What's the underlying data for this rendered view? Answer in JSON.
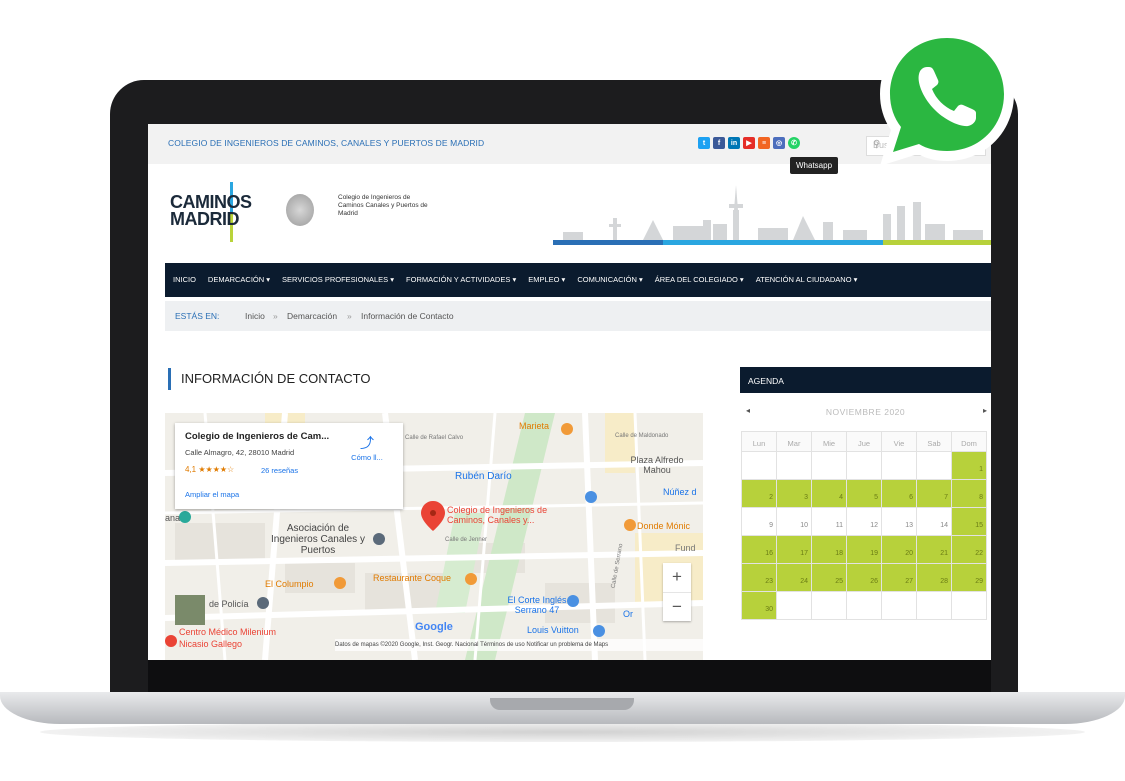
{
  "site": {
    "org_name": "COLEGIO DE INGENIEROS DE CAMINOS, CANALES Y PUERTOS DE MADRID",
    "tooltip": "Whatsapp",
    "search_placeholder": "Buscar...",
    "logo_line1": "CAMINOS",
    "logo_line2": "MADRID",
    "logo_sub": "Colegio de Ingenieros de Caminos Canales y Puertos de Madrid"
  },
  "socials": [
    {
      "icon": "twitter-icon",
      "glyph": "t",
      "color": "#1da1f2"
    },
    {
      "icon": "facebook-icon",
      "glyph": "f",
      "color": "#3b5998"
    },
    {
      "icon": "linkedin-icon",
      "glyph": "in",
      "color": "#0077b5"
    },
    {
      "icon": "youtube-icon",
      "glyph": "▶",
      "color": "#e52d27"
    },
    {
      "icon": "rss-icon",
      "glyph": "≡",
      "color": "#f26522"
    },
    {
      "icon": "instagram-icon",
      "glyph": "◎",
      "color": "#4c6ebd"
    },
    {
      "icon": "whatsapp-icon",
      "glyph": "✆",
      "color": "#25d366"
    }
  ],
  "nav": [
    "INICIO",
    "DEMARCACIÓN ▾",
    "SERVICIOS PROFESIONALES ▾",
    "FORMACIÓN Y ACTIVIDADES ▾",
    "EMPLEO ▾",
    "COMUNICACIÓN ▾",
    "ÁREA DEL COLEGIADO ▾",
    "ATENCIÓN AL CIUDADANO ▾"
  ],
  "breadcrumb": {
    "label": "ESTÁS EN:",
    "items": [
      "Inicio",
      "Demarcación",
      "Información de Contacto"
    ],
    "sep": "»"
  },
  "page_title": "INFORMACIÓN DE CONTACTO",
  "map": {
    "place_title": "Colegio de Ingenieros de Cam...",
    "address": "Calle Almagro, 42, 28010 Madrid",
    "rating": "4,1 ★★★★☆",
    "reviews": "26 reseñas",
    "directions": "Cómo ll...",
    "enlarge": "Ampliar el mapa",
    "labels": {
      "marieta": "Marieta",
      "ruben_dario": "Rubén Darío",
      "plaza": "Plaza Alfredo Mahou",
      "nunez": "Núñez d",
      "pin": "Colegio de Ingenieros de Caminos, Canales y...",
      "asociacion": "Asociación de Ingenieros Canales y Puertos",
      "donde": "Donde Mónic",
      "fund": "Fund",
      "el_columpio": "El Columpio",
      "restaurante": "Restaurante Coque",
      "policia": "de Policía",
      "corte_ingles": "El Corte Inglés Serrano 47",
      "louis": "Louis Vuitton",
      "centro": "Centro Médico Milenium",
      "nicasio": "Nicasio Gallego",
      "google": "Google",
      "calle_jenner": "Calle de Jenner",
      "calle_serrano": "Calle de Serrano",
      "ana": "ana",
      "calle_rafael": "Calle de Rafael Calvo",
      "calle_maldonado": "Calle de Maldonado",
      "ort": "Or",
      "zoom_in": "+",
      "zoom_out": "−"
    },
    "attribution": "Datos de mapas ©2020 Google, Inst. Geogr. Nacional   Términos de uso   Notificar un problema de Maps"
  },
  "agenda": {
    "title": "AGENDA",
    "month": "NOVIEMBRE 2020",
    "prev": "◂",
    "next": "▸",
    "weekdays": [
      "Lun",
      "Mar",
      "Mie",
      "Jue",
      "Vie",
      "Sab",
      "Dom"
    ],
    "weeks": [
      [
        "",
        "",
        "",
        "",
        "",
        "",
        "1"
      ],
      [
        "2",
        "3",
        "4",
        "5",
        "6",
        "7",
        "8"
      ],
      [
        "9",
        "10",
        "11",
        "12",
        "13",
        "14",
        "15"
      ],
      [
        "16",
        "17",
        "18",
        "19",
        "20",
        "21",
        "22"
      ],
      [
        "23",
        "24",
        "25",
        "26",
        "27",
        "28",
        "29"
      ],
      [
        "30",
        "",
        "",
        "",
        "",
        "",
        ""
      ]
    ],
    "event_days": [
      "1",
      "2",
      "3",
      "4",
      "5",
      "6",
      "7",
      "8",
      "15",
      "16",
      "17",
      "18",
      "19",
      "20",
      "21",
      "22",
      "23",
      "24",
      "25",
      "26",
      "27",
      "28",
      "29",
      "30"
    ],
    "event_color": "#b7d13b"
  }
}
